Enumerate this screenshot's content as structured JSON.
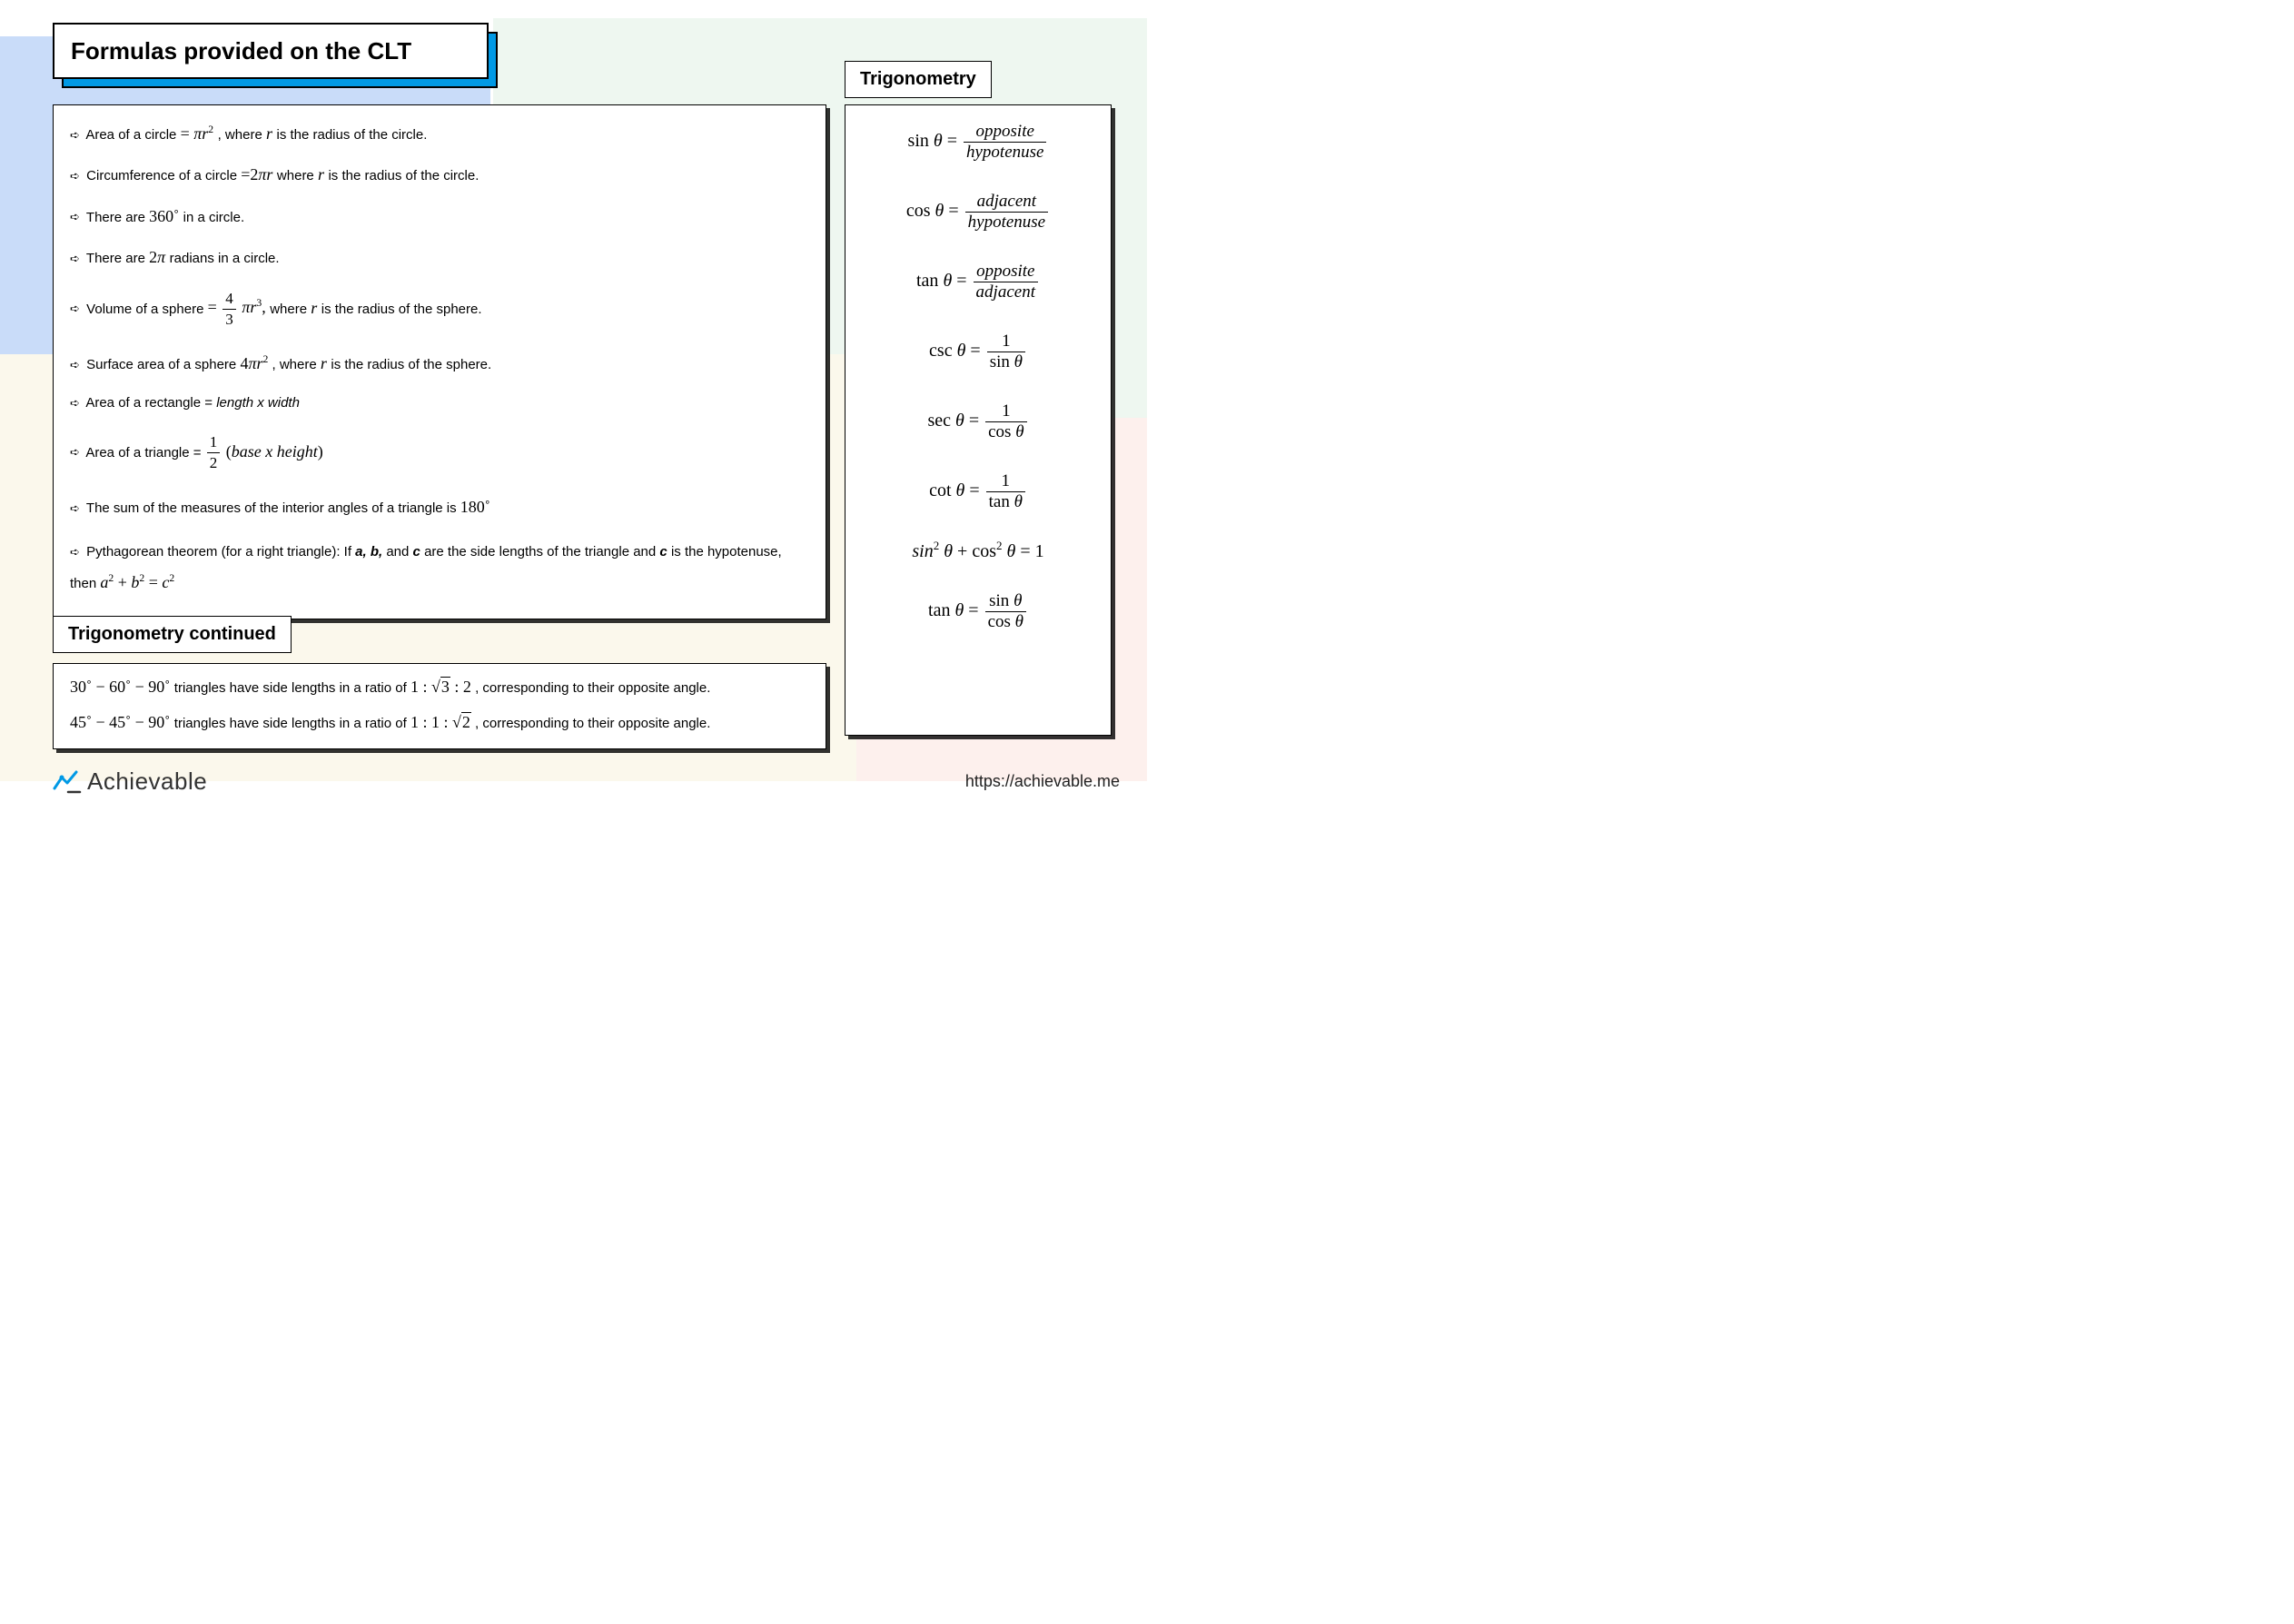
{
  "title": "Formulas provided on the CLT",
  "labels": {
    "trig": "Trigonometry",
    "trig_cont": "Trigonometry continued"
  },
  "main": {
    "l1_a": "Area of a circle",
    "l1_b": ", where",
    "l1_c": "is the radius of the circle.",
    "l2_a": "Circumference of a circle",
    "l2_b": "where",
    "l2_c": "is the radius of the circle.",
    "l3_a": "There are",
    "l3_b": "in a circle.",
    "l4_a": "There are",
    "l4_b": "radians in a circle.",
    "l5_a": "Volume of a sphere",
    "l5_b": "where",
    "l5_c": "is the radius of the sphere.",
    "l6_a": "Surface area of a sphere",
    "l6_b": ", where",
    "l6_c": "is the radius of the sphere.",
    "l7_a": "Area of a rectangle =",
    "l7_b": "length x width",
    "l8_a": "Area of a triangle =",
    "l9_a": "The sum of the measures of the interior angles of a triangle is",
    "l10_a": "Pythagorean theorem (for a right triangle): If",
    "l10_b": "a, b,",
    "l10_c": "and",
    "l10_d": "c",
    "l10_e": "are the side lengths of the triangle and",
    "l10_f": "c",
    "l10_g": "is the hypotenuse, then"
  },
  "trig_bottom": {
    "l1_a": "triangles have side lengths in a ratio of",
    "l1_b": ", corresponding to their opposite angle.",
    "l2_a": "triangles have side lengths in a ratio of",
    "l2_b": ", corresponding to their opposite angle."
  },
  "trig_right": {
    "opposite": "opposite",
    "adjacent": "adjacent",
    "hypotenuse": "hypotenuse"
  },
  "brand": "Achievable",
  "url": "https://achievable.me"
}
